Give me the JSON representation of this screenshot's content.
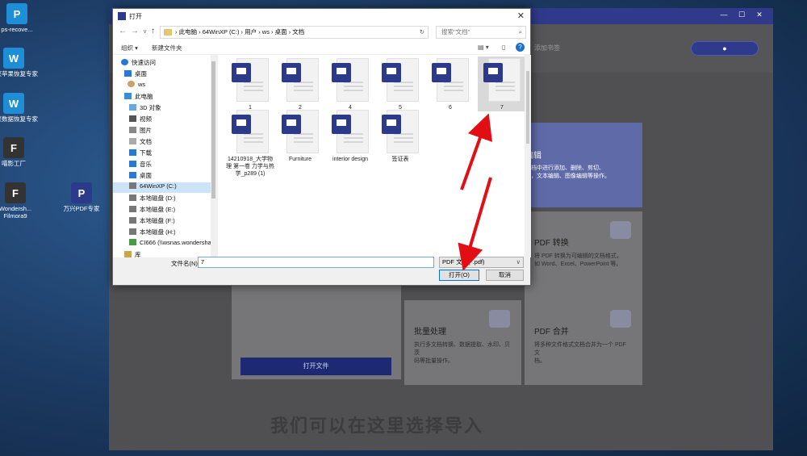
{
  "desktop": {
    "icons": [
      {
        "label": "ps-recove...",
        "glyph": "P"
      },
      {
        "label": "万兴苹果恢复专家",
        "glyph": "W"
      },
      {
        "label": "万兴数据恢复专家",
        "glyph": "W"
      },
      {
        "label": "喵影工厂",
        "glyph": "F"
      },
      {
        "label": "Wondersh... Filmora9",
        "glyph": "F"
      },
      {
        "label": "万兴PDF专家",
        "glyph": "P"
      }
    ]
  },
  "app": {
    "window_controls": [
      "—",
      "☐",
      "✕"
    ],
    "add_bookmark": "添加书签",
    "login_icon": "user-icon",
    "cards": {
      "edit": {
        "title": "编辑",
        "desc": "文档中进行添加、删除、剪切、\n图，文本编辑、图像编辑等操作。"
      },
      "convert": {
        "title": "PDF 转换",
        "desc": "将 PDF 转换为可编辑的文档格式，\n如 Word、Excel、PowerPoint 等。"
      },
      "batch": {
        "title": "批量处理",
        "desc": "执行多文档转换、数据提取、水印、贝茨\n码等批量操作。"
      },
      "merge": {
        "title": "PDF 合并",
        "desc": "将多种文件格式文档合并为一个 PDF 文\n档。"
      }
    },
    "open_file_button": "打开文件",
    "subtitle": "我们可以在这里选择导入"
  },
  "dialog": {
    "title": "打开",
    "close": "✕",
    "nav": {
      "back": "←",
      "forward": "→",
      "dropdown": "∨",
      "up": "↑"
    },
    "address": "›  此电脑  ›  64WinXP (C:)  ›  用户  ›  ws  ›  桌面  ›  文档",
    "address_refresh": "↻",
    "search_placeholder": "搜索\"文档\"",
    "organize": "组织 ▾",
    "new_folder": "新建文件夹",
    "help": "?",
    "tree": [
      {
        "label": "快速访问",
        "icon": "star-icon"
      },
      {
        "label": "桌面",
        "icon": "desktop-icon"
      },
      {
        "label": "ws",
        "icon": "user-icon"
      },
      {
        "label": "此电脑",
        "icon": "computer-icon"
      },
      {
        "label": "3D 对象",
        "icon": "3d-icon"
      },
      {
        "label": "视频",
        "icon": "video-icon"
      },
      {
        "label": "图片",
        "icon": "picture-icon"
      },
      {
        "label": "文档",
        "icon": "document-icon"
      },
      {
        "label": "下载",
        "icon": "download-icon"
      },
      {
        "label": "音乐",
        "icon": "music-icon"
      },
      {
        "label": "桌面",
        "icon": "desktop-icon"
      },
      {
        "label": "64WinXP  (C:)",
        "icon": "drive-icon",
        "selected": true
      },
      {
        "label": "本地磁盘 (D:)",
        "icon": "drive-icon"
      },
      {
        "label": "本地磁盘 (E:)",
        "icon": "drive-icon"
      },
      {
        "label": "本地磁盘 (F:)",
        "icon": "drive-icon"
      },
      {
        "label": "本地磁盘 (H:)",
        "icon": "drive-icon"
      },
      {
        "label": "CI666 (\\\\wsnas.wondershar",
        "icon": "network-drive-icon"
      },
      {
        "label": "库",
        "icon": "library-icon"
      }
    ],
    "files": [
      {
        "name": "1"
      },
      {
        "name": "2"
      },
      {
        "name": "4"
      },
      {
        "name": "5"
      },
      {
        "name": "6"
      },
      {
        "name": "7",
        "selected": true
      },
      {
        "name": "14210918_大学物理 第一卷 力学与热学_p289 (1)"
      },
      {
        "name": "Furniture"
      },
      {
        "name": "interior design"
      },
      {
        "name": "签证表"
      }
    ],
    "filename_label": "文件名(N):",
    "filename_value": "7",
    "filetype_value": "PDF 文件(*.pdf)",
    "open_button": "打开(O)",
    "cancel_button": "取消"
  }
}
